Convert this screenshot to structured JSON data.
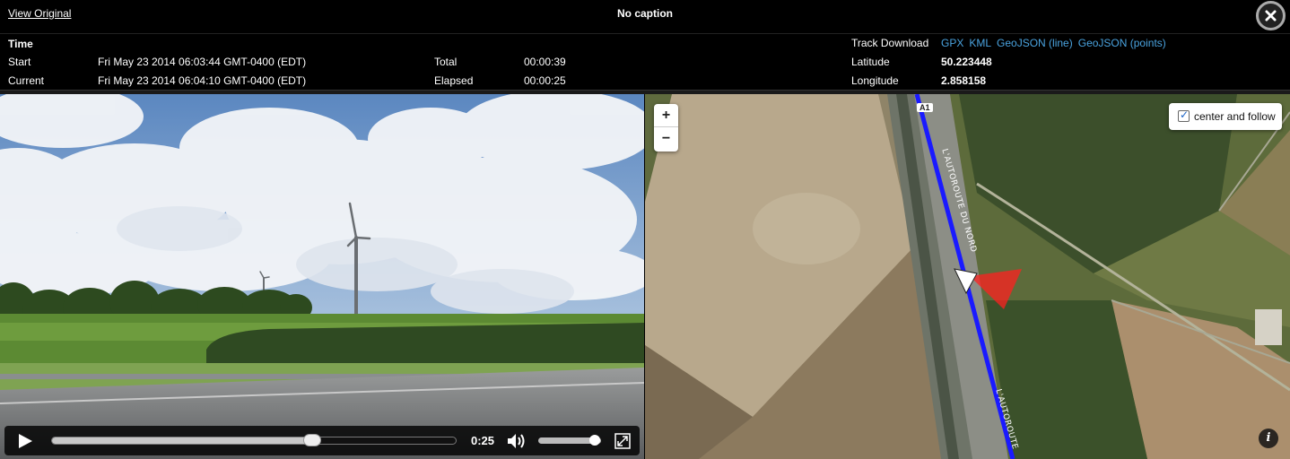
{
  "header": {
    "view_original": "View Original",
    "caption": "No caption",
    "close_symbol": "×"
  },
  "info": {
    "time_heading": "Time",
    "start_label": "Start",
    "start_value": "Fri May 23 2014 06:03:44 GMT-0400 (EDT)",
    "current_label": "Current",
    "current_value": "Fri May 23 2014 06:04:10 GMT-0400 (EDT)",
    "total_label": "Total",
    "total_value": "00:00:39",
    "elapsed_label": "Elapsed",
    "elapsed_value": "00:00:25",
    "track_download_label": "Track Download",
    "downloads": [
      "GPX",
      "KML",
      "GeoJSON (line)",
      "GeoJSON (points)"
    ],
    "latitude_label": "Latitude",
    "latitude_value": "50.223448",
    "longitude_label": "Longitude",
    "longitude_value": "2.858158"
  },
  "video": {
    "time_display": "0:25",
    "progress_fraction": 0.645,
    "volume_fraction": 0.9,
    "icons": [
      "play-icon",
      "volume-icon",
      "fullscreen-icon"
    ]
  },
  "map": {
    "zoom_in": "+",
    "zoom_out": "−",
    "follow_label": "center and follow",
    "follow_checked": true,
    "road_shield": "A1",
    "road_label_1": "L'AUTOROUTE DU NORD",
    "road_label_2": "L'AUTOROUTE",
    "info_symbol": "i",
    "track_color": "#1a1aff",
    "heading_color": "#ff2020"
  },
  "colors": {
    "link": "#4aa3df",
    "background": "#000000"
  }
}
